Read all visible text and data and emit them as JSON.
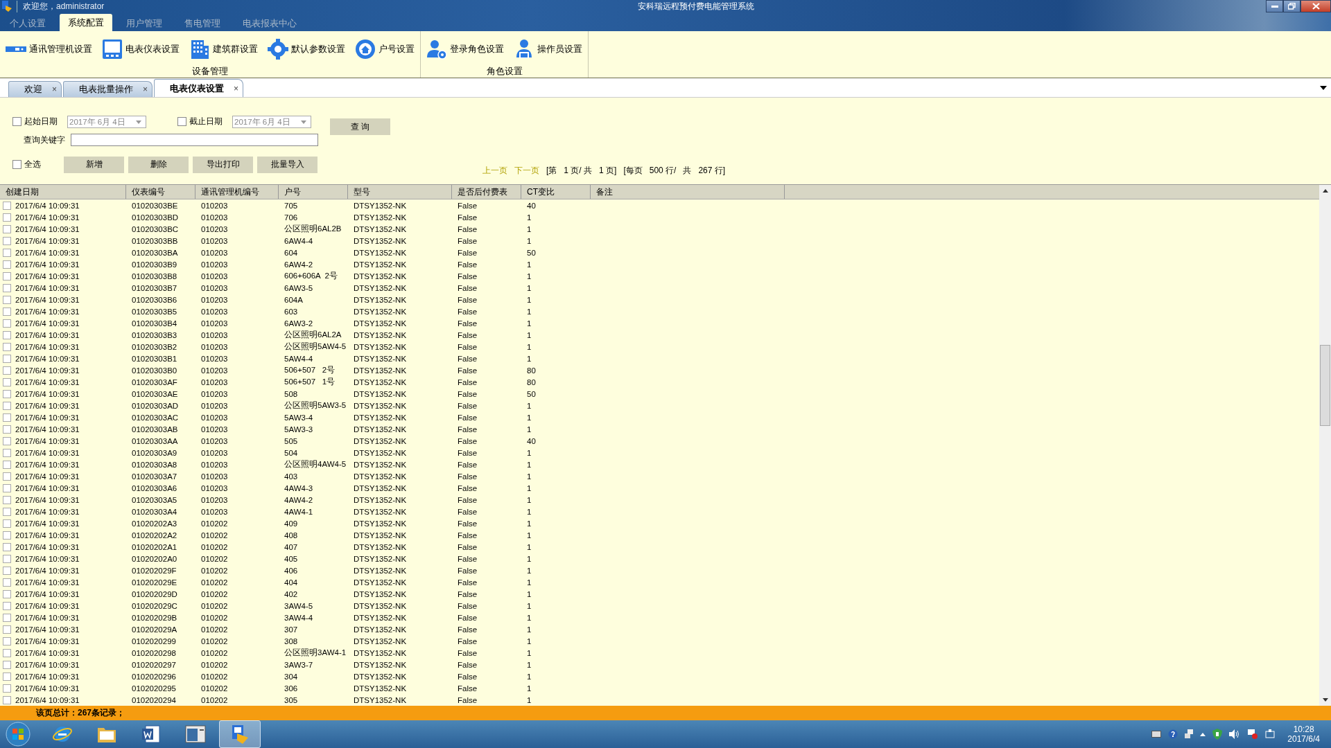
{
  "window": {
    "title": "安科瑞远程预付费电能管理系统",
    "welcome": "欢迎您，administrator"
  },
  "menu_tabs": [
    {
      "label": "个人设置",
      "selected": false
    },
    {
      "label": "系统配置",
      "selected": true
    },
    {
      "label": "用户管理",
      "selected": false
    },
    {
      "label": "售电管理",
      "selected": false
    },
    {
      "label": "电表报表中心",
      "selected": false
    }
  ],
  "ribbon_groups": [
    {
      "title": "设备管理",
      "items": [
        {
          "label": "通讯管理机设置",
          "kind": "device"
        },
        {
          "label": "电表仪表设置",
          "kind": "monitor"
        },
        {
          "label": "建筑群设置",
          "kind": "building"
        },
        {
          "label": "默认参数设置",
          "kind": "gear"
        },
        {
          "label": "户号设置",
          "kind": "house"
        }
      ]
    },
    {
      "title": "角色设置",
      "items": [
        {
          "label": "登录角色设置",
          "kind": "usergear"
        },
        {
          "label": "操作员设置",
          "kind": "operator"
        }
      ]
    }
  ],
  "doc_tabs": [
    {
      "label": "欢迎",
      "selected": false,
      "close": "×"
    },
    {
      "label": "电表批量操作",
      "selected": false,
      "close": "×"
    },
    {
      "label": "电表仪表设置",
      "selected": true,
      "close": "×"
    }
  ],
  "filters": {
    "start": {
      "label": "起始日期",
      "checked": false,
      "value": "2017年  6月  4日"
    },
    "end": {
      "label": "截止日期",
      "checked": false,
      "value": "2017年  6月  4日"
    },
    "keyword_label": "查询关键字",
    "query_button": "查 询",
    "select_all": {
      "label": "全选",
      "checked": false
    },
    "buttons": [
      "新增",
      "删除",
      "导出打印",
      "批量导入"
    ]
  },
  "pager": {
    "prev": "上一页",
    "next": "下一页",
    "texts": [
      "[第",
      "1 页/ 共",
      "1 页]",
      "[每页",
      "500 行/",
      "共",
      "267 行]"
    ]
  },
  "table": {
    "columns": [
      "创建日期",
      "仪表编号",
      "通讯管理机编号",
      "户号",
      "型号",
      "是否后付费表",
      "CT变比",
      "备注"
    ],
    "rows": [
      {
        "checked": false,
        "cells": [
          "2017/6/4 10:09:31",
          "01020303BE",
          "010203",
          "705",
          "DTSY1352-NK",
          "False",
          "40"
        ]
      },
      {
        "checked": false,
        "cells": [
          "2017/6/4 10:09:31",
          "01020303BD",
          "010203",
          "706",
          "DTSY1352-NK",
          "False",
          "1"
        ]
      },
      {
        "checked": false,
        "cells": [
          "2017/6/4 10:09:31",
          "01020303BC",
          "010203",
          "公区照明6AL2B",
          "DTSY1352-NK",
          "False",
          "1"
        ]
      },
      {
        "checked": false,
        "cells": [
          "2017/6/4 10:09:31",
          "01020303BB",
          "010203",
          "6AW4-4",
          "DTSY1352-NK",
          "False",
          "1"
        ]
      },
      {
        "checked": false,
        "cells": [
          "2017/6/4 10:09:31",
          "01020303BA",
          "010203",
          "604",
          "DTSY1352-NK",
          "False",
          "50"
        ]
      },
      {
        "checked": false,
        "cells": [
          "2017/6/4 10:09:31",
          "01020303B9",
          "010203",
          "6AW4-2",
          "DTSY1352-NK",
          "False",
          "1"
        ]
      },
      {
        "checked": false,
        "cells": [
          "2017/6/4 10:09:31",
          "01020303B8",
          "010203",
          "606+606A  2号",
          "DTSY1352-NK",
          "False",
          "1"
        ]
      },
      {
        "checked": false,
        "cells": [
          "2017/6/4 10:09:31",
          "01020303B7",
          "010203",
          "6AW3-5",
          "DTSY1352-NK",
          "False",
          "1"
        ]
      },
      {
        "checked": false,
        "cells": [
          "2017/6/4 10:09:31",
          "01020303B6",
          "010203",
          "604A",
          "DTSY1352-NK",
          "False",
          "1"
        ]
      },
      {
        "checked": false,
        "cells": [
          "2017/6/4 10:09:31",
          "01020303B5",
          "010203",
          "603",
          "DTSY1352-NK",
          "False",
          "1"
        ]
      },
      {
        "checked": false,
        "cells": [
          "2017/6/4 10:09:31",
          "01020303B4",
          "010203",
          "6AW3-2",
          "DTSY1352-NK",
          "False",
          "1"
        ]
      },
      {
        "checked": false,
        "cells": [
          "2017/6/4 10:09:31",
          "01020303B3",
          "010203",
          "公区照明6AL2A",
          "DTSY1352-NK",
          "False",
          "1"
        ]
      },
      {
        "checked": false,
        "cells": [
          "2017/6/4 10:09:31",
          "01020303B2",
          "010203",
          "公区照明5AW4-5",
          "DTSY1352-NK",
          "False",
          "1"
        ]
      },
      {
        "checked": false,
        "cells": [
          "2017/6/4 10:09:31",
          "01020303B1",
          "010203",
          "5AW4-4",
          "DTSY1352-NK",
          "False",
          "1"
        ]
      },
      {
        "checked": false,
        "cells": [
          "2017/6/4 10:09:31",
          "01020303B0",
          "010203",
          "506+507   2号",
          "DTSY1352-NK",
          "False",
          "80"
        ]
      },
      {
        "checked": false,
        "cells": [
          "2017/6/4 10:09:31",
          "01020303AF",
          "010203",
          "506+507   1号",
          "DTSY1352-NK",
          "False",
          "80"
        ]
      },
      {
        "checked": false,
        "cells": [
          "2017/6/4 10:09:31",
          "01020303AE",
          "010203",
          "508",
          "DTSY1352-NK",
          "False",
          "50"
        ]
      },
      {
        "checked": false,
        "cells": [
          "2017/6/4 10:09:31",
          "01020303AD",
          "010203",
          "公区照明5AW3-5",
          "DTSY1352-NK",
          "False",
          "1"
        ]
      },
      {
        "checked": false,
        "cells": [
          "2017/6/4 10:09:31",
          "01020303AC",
          "010203",
          "5AW3-4",
          "DTSY1352-NK",
          "False",
          "1"
        ]
      },
      {
        "checked": false,
        "cells": [
          "2017/6/4 10:09:31",
          "01020303AB",
          "010203",
          "5AW3-3",
          "DTSY1352-NK",
          "False",
          "1"
        ]
      },
      {
        "checked": false,
        "cells": [
          "2017/6/4 10:09:31",
          "01020303AA",
          "010203",
          "505",
          "DTSY1352-NK",
          "False",
          "40"
        ]
      },
      {
        "checked": false,
        "cells": [
          "2017/6/4 10:09:31",
          "01020303A9",
          "010203",
          "504",
          "DTSY1352-NK",
          "False",
          "1"
        ]
      },
      {
        "checked": false,
        "cells": [
          "2017/6/4 10:09:31",
          "01020303A8",
          "010203",
          "公区照明4AW4-5",
          "DTSY1352-NK",
          "False",
          "1"
        ]
      },
      {
        "checked": false,
        "cells": [
          "2017/6/4 10:09:31",
          "01020303A7",
          "010203",
          "403",
          "DTSY1352-NK",
          "False",
          "1"
        ]
      },
      {
        "checked": false,
        "cells": [
          "2017/6/4 10:09:31",
          "01020303A6",
          "010203",
          "4AW4-3",
          "DTSY1352-NK",
          "False",
          "1"
        ]
      },
      {
        "checked": false,
        "cells": [
          "2017/6/4 10:09:31",
          "01020303A5",
          "010203",
          "4AW4-2",
          "DTSY1352-NK",
          "False",
          "1"
        ]
      },
      {
        "checked": false,
        "cells": [
          "2017/6/4 10:09:31",
          "01020303A4",
          "010203",
          "4AW4-1",
          "DTSY1352-NK",
          "False",
          "1"
        ]
      },
      {
        "checked": false,
        "cells": [
          "2017/6/4 10:09:31",
          "01020202A3",
          "010202",
          "409",
          "DTSY1352-NK",
          "False",
          "1"
        ]
      },
      {
        "checked": false,
        "cells": [
          "2017/6/4 10:09:31",
          "01020202A2",
          "010202",
          "408",
          "DTSY1352-NK",
          "False",
          "1"
        ]
      },
      {
        "checked": false,
        "cells": [
          "2017/6/4 10:09:31",
          "01020202A1",
          "010202",
          "407",
          "DTSY1352-NK",
          "False",
          "1"
        ]
      },
      {
        "checked": false,
        "cells": [
          "2017/6/4 10:09:31",
          "01020202A0",
          "010202",
          "405",
          "DTSY1352-NK",
          "False",
          "1"
        ]
      },
      {
        "checked": false,
        "cells": [
          "2017/6/4 10:09:31",
          "010202029F",
          "010202",
          "406",
          "DTSY1352-NK",
          "False",
          "1"
        ]
      },
      {
        "checked": false,
        "cells": [
          "2017/6/4 10:09:31",
          "010202029E",
          "010202",
          "404",
          "DTSY1352-NK",
          "False",
          "1"
        ]
      },
      {
        "checked": false,
        "cells": [
          "2017/6/4 10:09:31",
          "010202029D",
          "010202",
          "402",
          "DTSY1352-NK",
          "False",
          "1"
        ]
      },
      {
        "checked": false,
        "cells": [
          "2017/6/4 10:09:31",
          "010202029C",
          "010202",
          "3AW4-5",
          "DTSY1352-NK",
          "False",
          "1"
        ]
      },
      {
        "checked": false,
        "cells": [
          "2017/6/4 10:09:31",
          "010202029B",
          "010202",
          "3AW4-4",
          "DTSY1352-NK",
          "False",
          "1"
        ]
      },
      {
        "checked": false,
        "cells": [
          "2017/6/4 10:09:31",
          "010202029A",
          "010202",
          "307",
          "DTSY1352-NK",
          "False",
          "1"
        ]
      },
      {
        "checked": false,
        "cells": [
          "2017/6/4 10:09:31",
          "0102020299",
          "010202",
          "308",
          "DTSY1352-NK",
          "False",
          "1"
        ]
      },
      {
        "checked": false,
        "cells": [
          "2017/6/4 10:09:31",
          "0102020298",
          "010202",
          "公区照明3AW4-1",
          "DTSY1352-NK",
          "False",
          "1"
        ]
      },
      {
        "checked": false,
        "cells": [
          "2017/6/4 10:09:31",
          "0102020297",
          "010202",
          "3AW3-7",
          "DTSY1352-NK",
          "False",
          "1"
        ]
      },
      {
        "checked": false,
        "cells": [
          "2017/6/4 10:09:31",
          "0102020296",
          "010202",
          "304",
          "DTSY1352-NK",
          "False",
          "1"
        ]
      },
      {
        "checked": false,
        "cells": [
          "2017/6/4 10:09:31",
          "0102020295",
          "010202",
          "306",
          "DTSY1352-NK",
          "False",
          "1"
        ]
      },
      {
        "checked": false,
        "cells": [
          "2017/6/4 10:09:31",
          "0102020294",
          "010202",
          "305",
          "DTSY1352-NK",
          "False",
          "1"
        ]
      }
    ]
  },
  "status_bar": "该页总计：267条记录；",
  "taskbar": {
    "apps": [
      {
        "kind": "ie",
        "selected": false
      },
      {
        "kind": "folder",
        "selected": false
      },
      {
        "kind": "word",
        "selected": false
      },
      {
        "kind": "window",
        "selected": false
      },
      {
        "kind": "app",
        "selected": true
      }
    ],
    "time": "10:28",
    "date": "2017/6/4"
  }
}
